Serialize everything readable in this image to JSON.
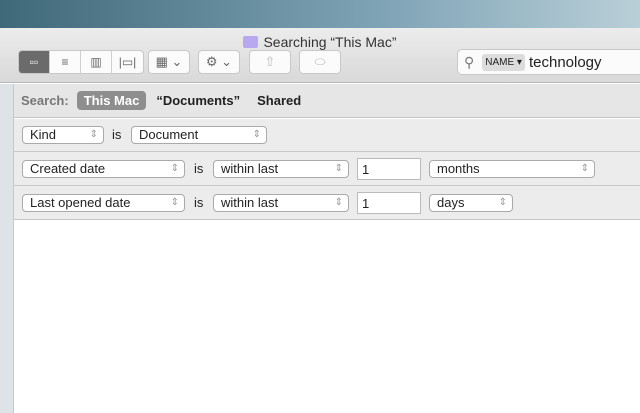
{
  "window": {
    "title": "Searching “This Mac”"
  },
  "toolbar": {
    "view_buttons": [
      {
        "name": "icon-view",
        "glyph": "▫▫"
      },
      {
        "name": "list-view",
        "glyph": "≡"
      },
      {
        "name": "column-view",
        "glyph": "▥"
      },
      {
        "name": "cover-flow-view",
        "glyph": "|▭|"
      }
    ],
    "arrange_glyph": "▦ ⌄",
    "action_glyph": "⚙ ⌄",
    "share_glyph": "⇧",
    "tag_glyph": "⬭",
    "search": {
      "token": "NAME ▾",
      "value": "technology"
    }
  },
  "scope": {
    "label": "Search:",
    "options": [
      "This Mac",
      "“Documents”",
      "Shared"
    ],
    "selected": "This Mac"
  },
  "criteria": [
    {
      "attribute": "Kind",
      "op": "is",
      "value": "Document"
    },
    {
      "attribute": "Created date",
      "op": "is",
      "condition": "within last",
      "amount": "1",
      "unit": "months"
    },
    {
      "attribute": "Last opened date",
      "op": "is",
      "condition": "within last",
      "amount": "1",
      "unit": "days"
    }
  ]
}
